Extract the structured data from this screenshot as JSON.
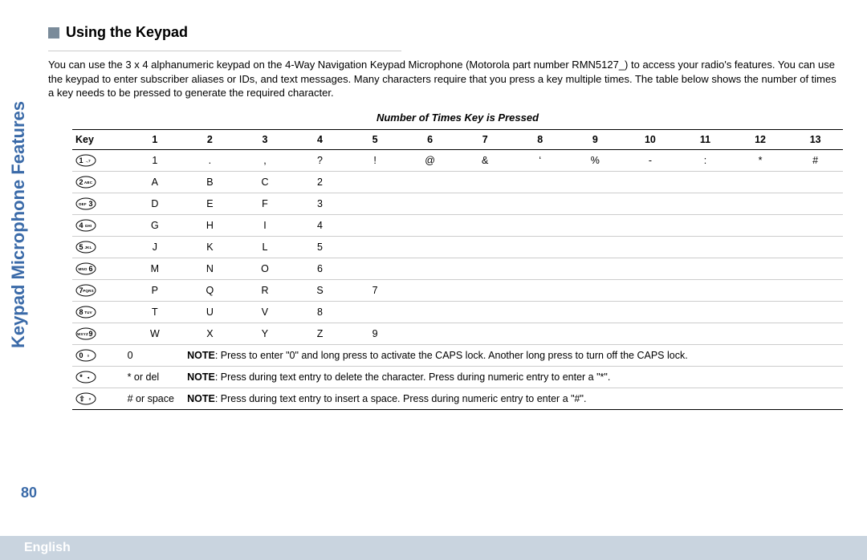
{
  "section": {
    "title": "Using the Keypad",
    "intro": "You can use the 3 x 4 alphanumeric keypad on the 4-Way Navigation Keypad Microphone (Motorola part number RMN5127_) to access your radio's features. You can use the keypad to enter subscriber aliases or IDs, and text messages. Many characters require that you press a key multiple times. The table below shows the number of times a key needs to be pressed to generate the required character."
  },
  "table": {
    "title": "Number of Times Key is Pressed",
    "key_header": "Key",
    "col_headers": [
      "1",
      "2",
      "3",
      "4",
      "5",
      "6",
      "7",
      "8",
      "9",
      "10",
      "11",
      "12",
      "13"
    ],
    "rows": [
      {
        "keyLeft": "1",
        "keyRight": ".,?",
        "cells": [
          "1",
          ".",
          ",",
          "?",
          "!",
          "@",
          "&",
          "‘",
          "%",
          "-",
          ":",
          "*",
          "#"
        ]
      },
      {
        "keyLeft": "2",
        "keyRight": "ABC",
        "cells": [
          "A",
          "B",
          "C",
          "2",
          "",
          "",
          "",
          "",
          "",
          "",
          "",
          "",
          ""
        ]
      },
      {
        "keyLeft": "DEF",
        "keyRight": "3",
        "cells": [
          "D",
          "E",
          "F",
          "3",
          "",
          "",
          "",
          "",
          "",
          "",
          "",
          "",
          ""
        ]
      },
      {
        "keyLeft": "4",
        "keyRight": "GHI",
        "cells": [
          "G",
          "H",
          "I",
          "4",
          "",
          "",
          "",
          "",
          "",
          "",
          "",
          "",
          ""
        ]
      },
      {
        "keyLeft": "5",
        "keyRight": "JKL",
        "cells": [
          "J",
          "K",
          "L",
          "5",
          "",
          "",
          "",
          "",
          "",
          "",
          "",
          "",
          ""
        ]
      },
      {
        "keyLeft": "MNO",
        "keyRight": "6",
        "cells": [
          "M",
          "N",
          "O",
          "6",
          "",
          "",
          "",
          "",
          "",
          "",
          "",
          "",
          ""
        ]
      },
      {
        "keyLeft": "7",
        "keyRight": "PQRS",
        "cells": [
          "P",
          "Q",
          "R",
          "S",
          "7",
          "",
          "",
          "",
          "",
          "",
          "",
          "",
          ""
        ]
      },
      {
        "keyLeft": "8",
        "keyRight": "TUV",
        "cells": [
          "T",
          "U",
          "V",
          "8",
          "",
          "",
          "",
          "",
          "",
          "",
          "",
          "",
          ""
        ]
      },
      {
        "keyLeft": "WXYZ",
        "keyRight": "9",
        "cells": [
          "W",
          "X",
          "Y",
          "Z",
          "9",
          "",
          "",
          "",
          "",
          "",
          "",
          "",
          ""
        ]
      },
      {
        "keyLeft": "0",
        "keyRight": "◊",
        "firstCell": "0",
        "noteLabel": "NOTE",
        "noteText": ": Press to enter \"0\" and long press to activate the CAPS lock. Another long press to turn off the CAPS lock."
      },
      {
        "keyLeft": "*",
        "keyRight": "◂",
        "firstCell": "* or del",
        "noteLabel": "NOTE",
        "noteText": ": Press during text entry to delete the character. Press during numeric entry to enter a \"*\"."
      },
      {
        "keyLeft": "⇧",
        "keyRight": "#",
        "firstCell": "# or space",
        "noteLabel": "NOTE",
        "noteText": ": Press during text entry to insert a space. Press during numeric entry to enter a \"#\"."
      }
    ]
  },
  "sidebar": "Keypad Microphone Features",
  "page_number": "80",
  "footer": "English"
}
